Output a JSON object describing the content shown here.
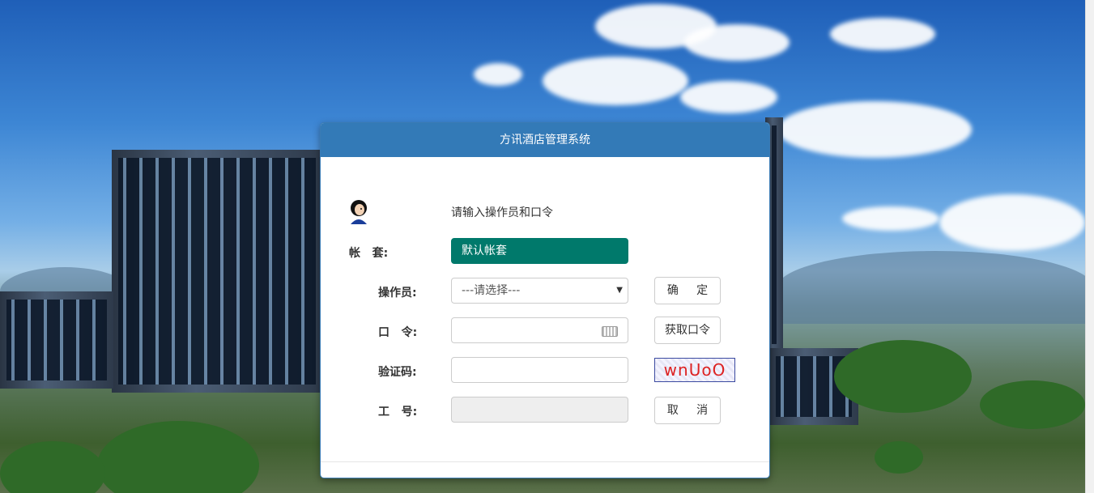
{
  "dialog": {
    "title": "方讯酒店管理系统",
    "prompt": "请输入操作员和口令"
  },
  "form": {
    "account_label": "帐   套:",
    "account_value": "默认帐套",
    "operator_label": "操作员:",
    "operator_selected": "---请选择---",
    "password_label": "口   令:",
    "password_value": "",
    "captcha_label": "验证码:",
    "captcha_value": "",
    "captcha_text": "wnUoO",
    "workno_label": "工   号:",
    "workno_value": ""
  },
  "buttons": {
    "confirm": "确     定",
    "get_password": "获取口令",
    "cancel": "取     消"
  },
  "colors": {
    "header": "#337ab7",
    "account_bg": "#00796b"
  }
}
